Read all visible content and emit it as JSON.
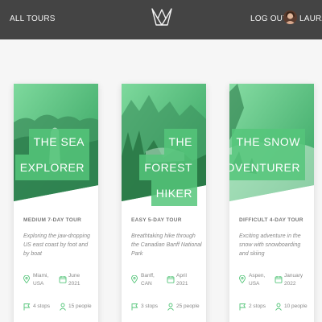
{
  "header": {
    "nav_all": "ALL TOURS",
    "logout": "LOG OUT",
    "user": "LAURA"
  },
  "colors": {
    "accent": "#55c57a",
    "header_bg": "#444444",
    "page_bg": "#f6f6f6"
  },
  "tours": [
    {
      "title_lines": [
        "THE SEA",
        "EXPLORER"
      ],
      "subtitle": "MEDIUM 7-DAY TOUR",
      "description": "Exploring the jaw-dropping US east coast by foot and by boat",
      "location": [
        "Miami,",
        "USA"
      ],
      "date": [
        "June",
        "2021"
      ],
      "stops": "4 stops",
      "people": "15 people"
    },
    {
      "title_lines": [
        "THE",
        "FOREST",
        "HIKER"
      ],
      "subtitle": "EASY 5-DAY TOUR",
      "description": "Breathtaking hike through the Canadian Banff National Park",
      "location": [
        "Banff,",
        "CAN"
      ],
      "date": [
        "April",
        "2021"
      ],
      "stops": "3 stops",
      "people": "25 people"
    },
    {
      "title_lines": [
        "THE SNOW",
        "ADVENTURER"
      ],
      "subtitle": "DIFFICULT 4-DAY TOUR",
      "description": "Exciting adventure in the snow with snowboarding and skiing",
      "location": [
        "Aspen,",
        "USA"
      ],
      "date": [
        "January",
        "2022"
      ],
      "stops": "2 stops",
      "people": "10 people"
    }
  ]
}
